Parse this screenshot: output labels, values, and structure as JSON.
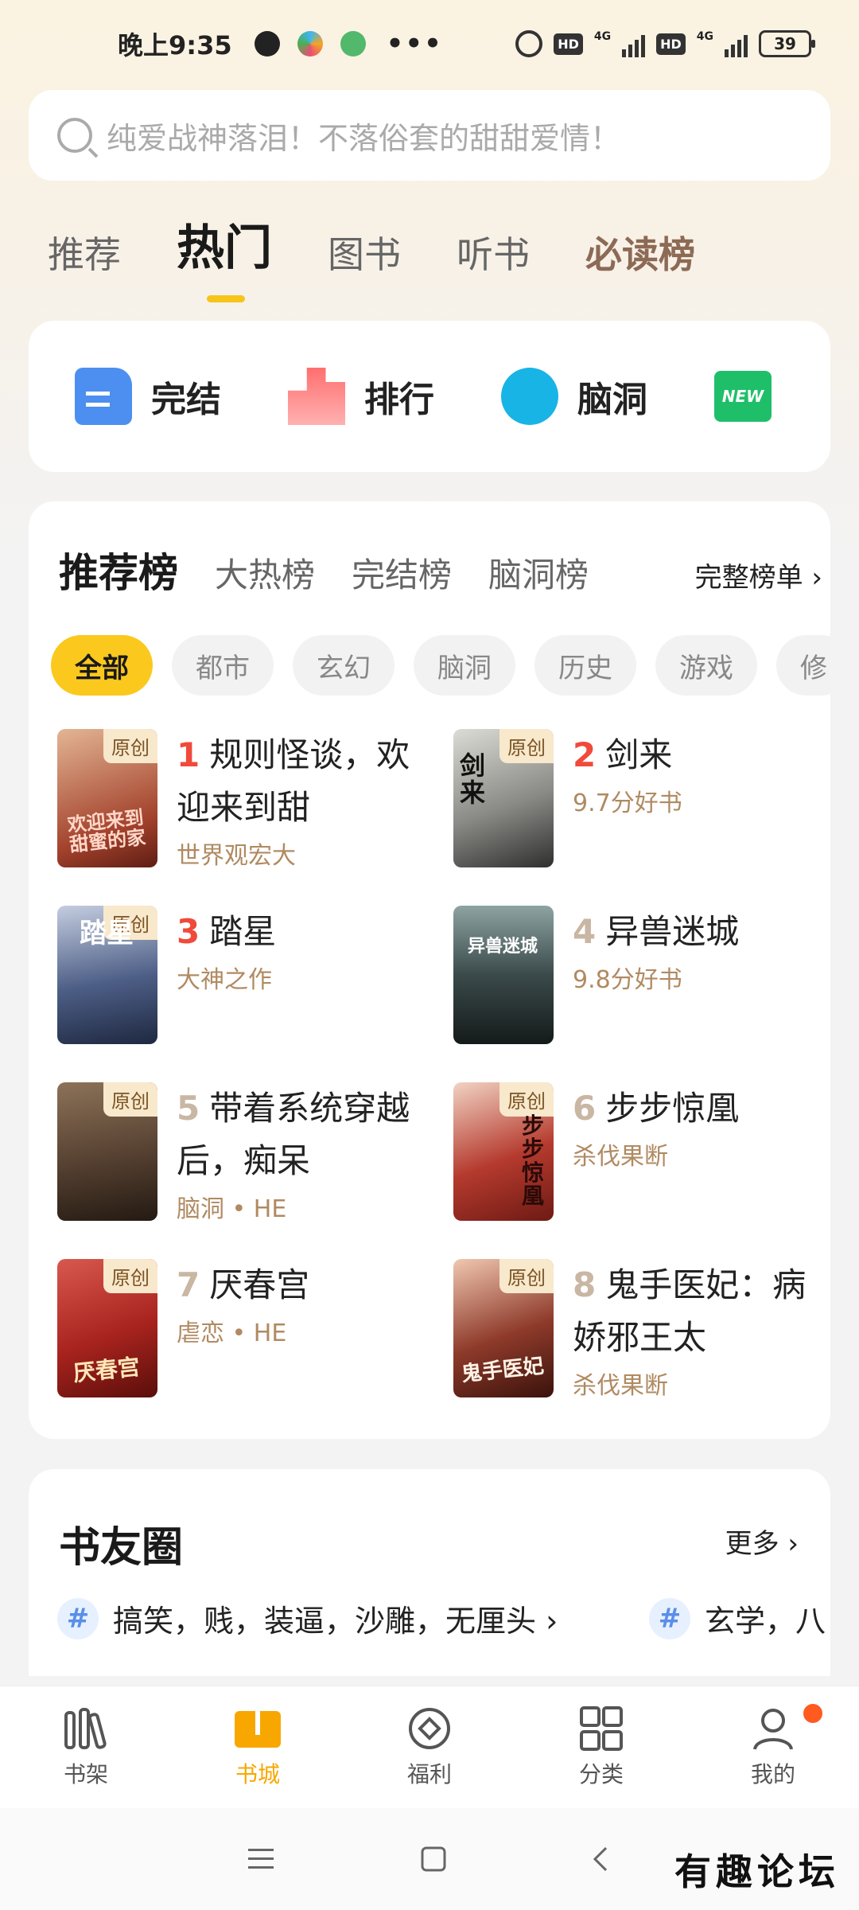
{
  "status_bar": {
    "time": "晚上9:35",
    "hd1": "HD",
    "hd2": "HD",
    "net1": "4G",
    "net2": "4G",
    "battery": "39",
    "more": "•••"
  },
  "search": {
    "placeholder": "纯爱战神落泪！不落俗套的甜甜爱情！"
  },
  "top_tabs": [
    "推荐",
    "热门",
    "图书",
    "听书",
    "必读榜"
  ],
  "quick_entries": [
    {
      "label": "完结",
      "icon": "book-done-icon"
    },
    {
      "label": "排行",
      "icon": "podium-icon"
    },
    {
      "label": "脑洞",
      "icon": "crystal-ball-icon"
    },
    {
      "label": "NEW",
      "icon": "new-badge-icon"
    }
  ],
  "rank": {
    "tabs": [
      "推荐榜",
      "大热榜",
      "完结榜",
      "脑洞榜"
    ],
    "more": "完整榜单 ›",
    "chips": [
      "全部",
      "都市",
      "玄幻",
      "脑洞",
      "历史",
      "游戏",
      "修"
    ],
    "badge": "原创",
    "books": [
      {
        "rank": "1",
        "title": "规则怪谈，欢迎来到甜",
        "tag": "世界观宏大",
        "cover_text": "欢迎来到甜蜜的家",
        "color": "#a3422c"
      },
      {
        "rank": "2",
        "title": "剑来",
        "tag": "9.7分好书",
        "cover_text": "剑来",
        "color": "#8a8a86"
      },
      {
        "rank": "3",
        "title": "踏星",
        "tag": "大神之作",
        "cover_text": "踏星",
        "color": "#4d5e86"
      },
      {
        "rank": "4",
        "title": "异兽迷城",
        "tag": "9.8分好书",
        "cover_text": "异兽迷城",
        "color": "#3b4a4a"
      },
      {
        "rank": "5",
        "title": "带着系统穿越后，痴呆",
        "tag": "脑洞 • HE",
        "cover_text": "",
        "color": "#5a4434"
      },
      {
        "rank": "6",
        "title": "步步惊凰",
        "tag": "杀伐果断",
        "cover_text": "步步惊凰",
        "color": "#b53a2e"
      },
      {
        "rank": "7",
        "title": "厌春宫",
        "tag": "虐恋 • HE",
        "cover_text": "厌春宫",
        "color": "#a8231e"
      },
      {
        "rank": "8",
        "title": "鬼手医妃：病娇邪王太",
        "tag": "杀伐果断",
        "cover_text": "鬼手医妃",
        "color": "#8e3a2a"
      }
    ]
  },
  "friends": {
    "title": "书友圈",
    "more": "更多 ›",
    "topics": [
      "搞笑，贱，装逼，沙雕，无厘头 ›",
      "玄学，八"
    ]
  },
  "bottom_nav": [
    "书架",
    "书城",
    "福利",
    "分类",
    "我的"
  ],
  "watermark": "有趣论坛",
  "colors": {
    "accent": "#f7c51a",
    "rank_top": "#f04a3b",
    "tag": "#b08a62"
  }
}
